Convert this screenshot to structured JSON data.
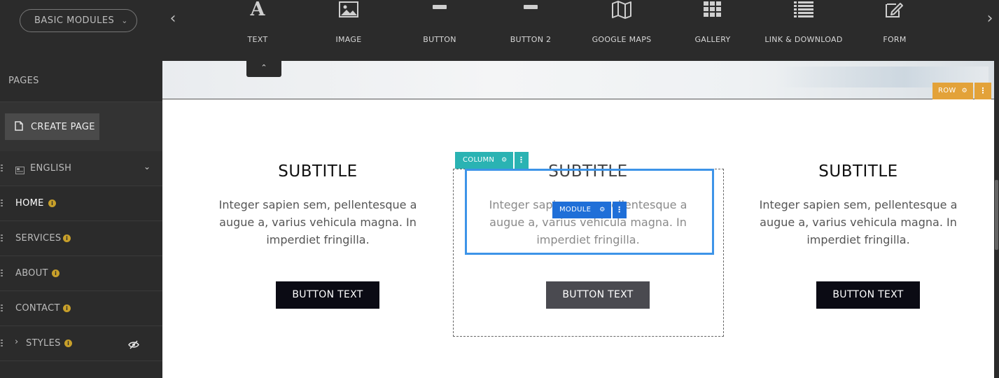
{
  "toolbar": {
    "dropdown_label": "BASIC MODULES",
    "modules": [
      {
        "label": "TEXT",
        "icon": "text-a-icon"
      },
      {
        "label": "IMAGE",
        "icon": "image-icon"
      },
      {
        "label": "BUTTON",
        "icon": "button-icon"
      },
      {
        "label": "BUTTON 2",
        "icon": "button-icon"
      },
      {
        "label": "GOOGLE MAPS",
        "icon": "map-icon"
      },
      {
        "label": "GALLERY",
        "icon": "grid-icon"
      },
      {
        "label": "LINK & DOWNLOAD",
        "icon": "list-icon"
      },
      {
        "label": "FORM",
        "icon": "edit-form-icon"
      }
    ]
  },
  "sidebar": {
    "title": "PAGES",
    "create_page_label": "CREATE PAGE",
    "language_label": "ENGLISH",
    "items": [
      {
        "label": "HOME",
        "active": true
      },
      {
        "label": "SERVICES",
        "active": false
      },
      {
        "label": "ABOUT",
        "active": false
      },
      {
        "label": "CONTACT",
        "active": false
      },
      {
        "label": "STYLES",
        "active": false
      }
    ]
  },
  "editor": {
    "row_label": "ROW",
    "column_label": "COLUMN",
    "module_label": "MODULE",
    "columns": [
      {
        "subtitle": "SUBTITLE",
        "text": "Integer sapien sem, pellentesque a augue a, varius vehicula magna. In imperdiet fringilla.",
        "button": "BUTTON TEXT"
      },
      {
        "subtitle": "SUBTITLE",
        "text": "Integer sapien sem, pellentesque a augue a, varius vehicula magna. In imperdiet fringilla.",
        "button": "BUTTON TEXT"
      },
      {
        "subtitle": "SUBTITLE",
        "text": "Integer sapien sem, pellentesque a augue a, varius vehicula magna. In imperdiet fringilla.",
        "button": "BUTTON TEXT"
      }
    ]
  },
  "colors": {
    "row_accent": "#e3a239",
    "column_accent": "#2ab3b3",
    "module_accent": "#1f6fd8",
    "info_badge": "#c8a02a"
  }
}
